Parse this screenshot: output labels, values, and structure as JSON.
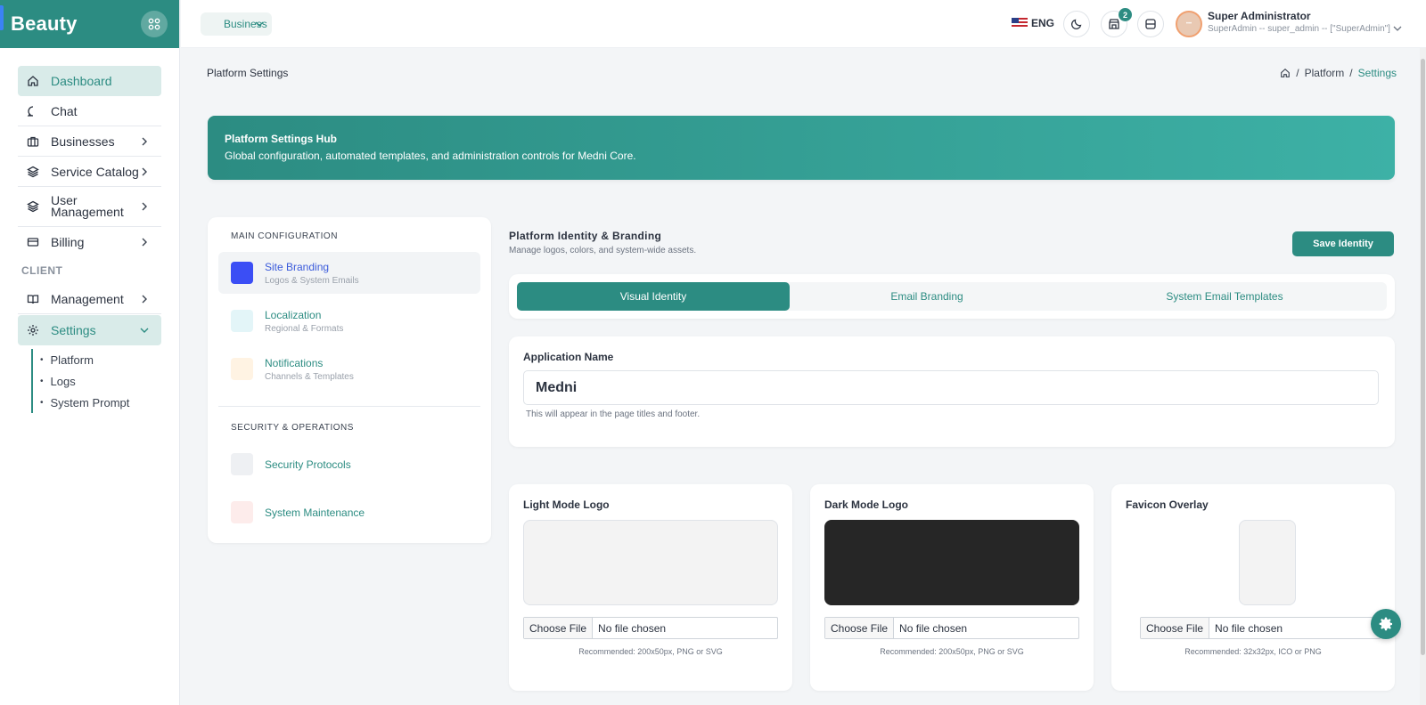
{
  "app": {
    "brand": "Beauty"
  },
  "sidebar": {
    "items": [
      {
        "label": "Dashboard",
        "icon": "home-icon"
      },
      {
        "label": "Chat",
        "icon": "chat-icon"
      },
      {
        "label": "Businesses",
        "icon": "briefcase-icon"
      },
      {
        "label": "Service Catalog",
        "icon": "layers-icon"
      },
      {
        "label": "User Management",
        "icon": "layers-icon"
      },
      {
        "label": "Billing",
        "icon": "credit-card-icon"
      }
    ],
    "section_client": "CLIENT",
    "client_items": [
      {
        "label": "Management",
        "icon": "book-icon"
      },
      {
        "label": "Settings",
        "icon": "gear-icon"
      }
    ],
    "settings_sub": [
      "Platform",
      "Logs",
      "System Prompt"
    ]
  },
  "topbar": {
    "business_pill": "Business",
    "language": "ENG",
    "notif_count": "2",
    "user_name": "Super Administrator",
    "user_role": "SuperAdmin -- super_admin -- [\"SuperAdmin\"]"
  },
  "page": {
    "title": "Platform Settings",
    "breadcrumb": [
      "Platform",
      "Settings"
    ]
  },
  "hero": {
    "title": "Platform Settings Hub",
    "subtitle": "Global configuration, automated templates, and administration controls for Medni Core."
  },
  "config_menu": {
    "main_label": "MAIN CONFIGURATION",
    "main_items": [
      {
        "title": "Site Branding",
        "sub": "Logos & System Emails",
        "color": "#3b4ef5"
      },
      {
        "title": "Localization",
        "sub": "Regional & Formats",
        "color": "#e3f5f8"
      },
      {
        "title": "Notifications",
        "sub": "Channels & Templates",
        "color": "#fff3e3"
      }
    ],
    "sec_label": "SECURITY & OPERATIONS",
    "sec_items": [
      {
        "title": "Security Protocols",
        "color": "#eef0f3"
      },
      {
        "title": "System Maintenance",
        "color": "#fdeceb"
      }
    ]
  },
  "branding": {
    "title": "Platform Identity & Branding",
    "subtitle": "Manage logos, colors, and system-wide assets.",
    "save_label": "Save Identity",
    "tabs": [
      "Visual Identity",
      "Email Branding",
      "System Email Templates"
    ],
    "app_name_label": "Application Name",
    "app_name_value": "Medni",
    "app_name_help": "This will appear in the page titles and footer."
  },
  "logos": [
    {
      "label": "Light Mode Logo",
      "choose": "Choose File",
      "file": "No file chosen",
      "rec": "Recommended: 200x50px, PNG or SVG",
      "bg": "#f3f3f3"
    },
    {
      "label": "Dark Mode Logo",
      "choose": "Choose File",
      "file": "No file chosen",
      "rec": "Recommended: 200x50px, PNG or SVG",
      "bg": "#262626"
    },
    {
      "label": "Favicon Overlay",
      "choose": "Choose File",
      "file": "No file chosen",
      "rec": "Recommended: 32x32px, ICO or PNG",
      "bg": "#f3f3f3"
    }
  ],
  "colors": {
    "accent": "#2c8c82",
    "active_link": "#3b5bdb"
  }
}
